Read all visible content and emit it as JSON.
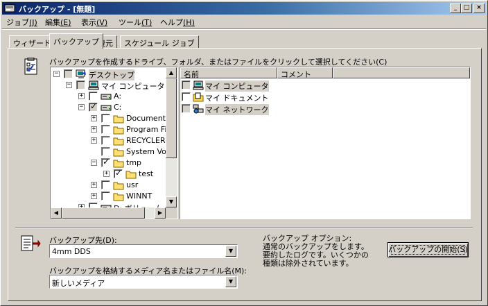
{
  "window": {
    "title": "バックアップ - [無題]"
  },
  "title_buttons": {
    "minimize": "_",
    "maximize": "□",
    "close": "×"
  },
  "menu": [
    {
      "label": "ジョブ",
      "key": "(J)"
    },
    {
      "label": "編集",
      "key": "(E)"
    },
    {
      "label": "表示",
      "key": "(V)"
    },
    {
      "label": "ツール",
      "key": "(T)"
    },
    {
      "label": "ヘルプ",
      "key": "(H)"
    }
  ],
  "tabs": [
    {
      "label": "ウィザード",
      "active": false
    },
    {
      "label": "バックアップ",
      "active": true
    },
    {
      "label": "復元",
      "active": false
    },
    {
      "label": "スケジュール ジョブ",
      "active": false
    }
  ],
  "instruction": "バックアップを作成するドライブ、フォルダ、またはファイルをクリックして選択してください(C)",
  "tree": [
    {
      "label": "デスクトップ",
      "expander": "−",
      "checked": false,
      "gray": true,
      "icon": "desktop-icon",
      "selected": true
    },
    {
      "label": "マイ コンピュータ",
      "expander": "−",
      "checked": false,
      "gray": true,
      "icon": "computer-icon"
    },
    {
      "label": "A:",
      "expander": "+",
      "checked": false,
      "gray": false,
      "icon": "floppy-drive-icon"
    },
    {
      "label": "C:",
      "expander": "−",
      "checked": true,
      "gray": true,
      "icon": "hard-drive-icon"
    },
    {
      "label": "Documents and Settings",
      "expander": "+",
      "checked": false,
      "gray": false,
      "icon": "folder-icon"
    },
    {
      "label": "Program Files",
      "expander": "+",
      "checked": false,
      "gray": false,
      "icon": "folder-icon"
    },
    {
      "label": "RECYCLER",
      "expander": "+",
      "checked": false,
      "gray": false,
      "icon": "folder-icon"
    },
    {
      "label": "System Volume Information",
      "expander": "",
      "checked": false,
      "gray": false,
      "icon": "folder-icon"
    },
    {
      "label": "tmp",
      "expander": "−",
      "checked": true,
      "gray": false,
      "icon": "folder-icon"
    },
    {
      "label": "test",
      "expander": "+",
      "checked": true,
      "gray": false,
      "icon": "folder-icon"
    },
    {
      "label": "usr",
      "expander": "+",
      "checked": false,
      "gray": false,
      "icon": "folder-icon"
    },
    {
      "label": "WINNT",
      "expander": "+",
      "checked": false,
      "gray": false,
      "icon": "folder-icon"
    },
    {
      "label": "D: ボリューム",
      "expander": "+",
      "checked": false,
      "gray": false,
      "icon": "hard-drive-icon"
    }
  ],
  "list": {
    "columns": [
      "名前",
      "コメント"
    ],
    "rows": [
      {
        "label": "マイ コンピュータ",
        "gray": true,
        "icon": "computer-icon"
      },
      {
        "label": "マイ ドキュメント",
        "gray": false,
        "icon": "documents-folder-icon"
      },
      {
        "label": "マイ ネットワーク",
        "gray": true,
        "icon": "network-icon"
      }
    ]
  },
  "destination": {
    "label": "バックアップ先(D):",
    "value": "4mm DDS"
  },
  "media": {
    "label": "バックアップを格納するメディア名またはファイル名(M):",
    "value": "新しいメディア"
  },
  "options": {
    "heading": "バックアップ オプション:",
    "text": "通常のバックアップをします。要約したログです。いくつかの種類は除外されています。"
  },
  "start_button": "バックアップの開始(S)"
}
